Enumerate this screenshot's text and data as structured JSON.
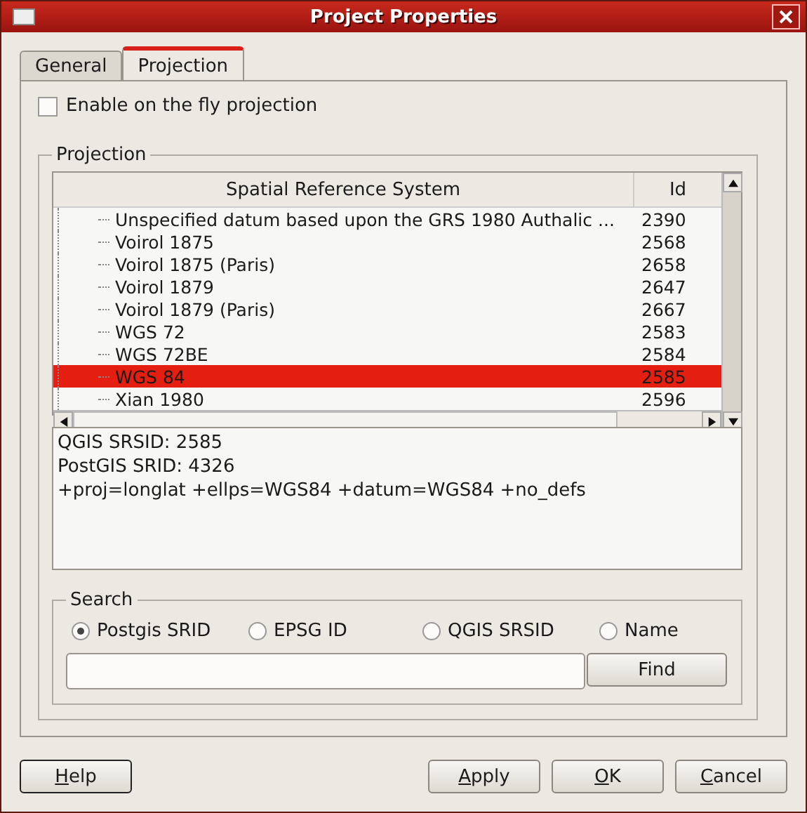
{
  "window": {
    "title": "Project Properties"
  },
  "tabs": [
    {
      "label": "General",
      "selected": false
    },
    {
      "label": "Projection",
      "selected": true
    }
  ],
  "fly_projection": {
    "label": "Enable on the fly projection",
    "checked": false
  },
  "projection": {
    "title": "Projection",
    "table": {
      "columns": [
        "Spatial Reference System",
        "Id"
      ],
      "rows": [
        {
          "name": "Unspecified datum based upon the GRS 1980 Authalic ...",
          "id": "2390",
          "selected": false
        },
        {
          "name": "Voirol 1875",
          "id": "2568",
          "selected": false
        },
        {
          "name": "Voirol 1875 (Paris)",
          "id": "2658",
          "selected": false
        },
        {
          "name": "Voirol 1879",
          "id": "2647",
          "selected": false
        },
        {
          "name": "Voirol 1879 (Paris)",
          "id": "2667",
          "selected": false
        },
        {
          "name": "WGS 72",
          "id": "2583",
          "selected": false
        },
        {
          "name": "WGS 72BE",
          "id": "2584",
          "selected": false
        },
        {
          "name": "WGS 84",
          "id": "2585",
          "selected": true
        },
        {
          "name": "Xian 1980",
          "id": "2596",
          "selected": false
        }
      ]
    },
    "info": [
      "QGIS SRSID: 2585",
      "PostGIS SRID: 4326",
      "+proj=longlat +ellps=WGS84 +datum=WGS84 +no_defs"
    ],
    "search": {
      "title": "Search",
      "options": [
        {
          "label": "Postgis SRID",
          "selected": true
        },
        {
          "label": "EPSG ID",
          "selected": false
        },
        {
          "label": "QGIS SRSID",
          "selected": false
        },
        {
          "label": "Name",
          "selected": false
        }
      ],
      "button": "Find"
    }
  },
  "buttons": {
    "help": "Help",
    "actions": [
      "Apply",
      "OK",
      "Cancel"
    ]
  }
}
